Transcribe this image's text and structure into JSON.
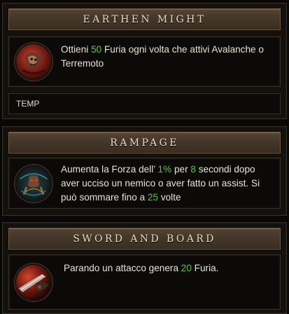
{
  "skills": [
    {
      "title": "EARTHEN MIGHT",
      "icon": "earthen-might-icon",
      "desc": [
        {
          "t": "Ottieni "
        },
        {
          "t": "50",
          "hl": true
        },
        {
          "t": " Furia ogni volta che attivi Avalanche o Terremoto"
        }
      ],
      "footer": "TEMP"
    },
    {
      "title": "RAMPAGE",
      "icon": "rampage-icon",
      "desc": [
        {
          "t": "Aumenta la Forza dell’ "
        },
        {
          "t": "1%",
          "hl": true
        },
        {
          "t": " per "
        },
        {
          "t": "8",
          "hl": true
        },
        {
          "t": " secondi dopo aver ucciso un nemico o aver fatto un assist. Si può sommare fino a "
        },
        {
          "t": "25",
          "hl": true
        },
        {
          "t": " volte"
        }
      ]
    },
    {
      "title": "SWORD AND BOARD",
      "icon": "sword-and-board-icon",
      "desc": [
        {
          "t": "Parando un attacco genera "
        },
        {
          "t": "20",
          "hl": true
        },
        {
          "t": " Furia."
        }
      ]
    }
  ],
  "colors": {
    "highlight": "#4fcc3a",
    "text": "#e8e2d6",
    "title": "#e8dcc8"
  }
}
